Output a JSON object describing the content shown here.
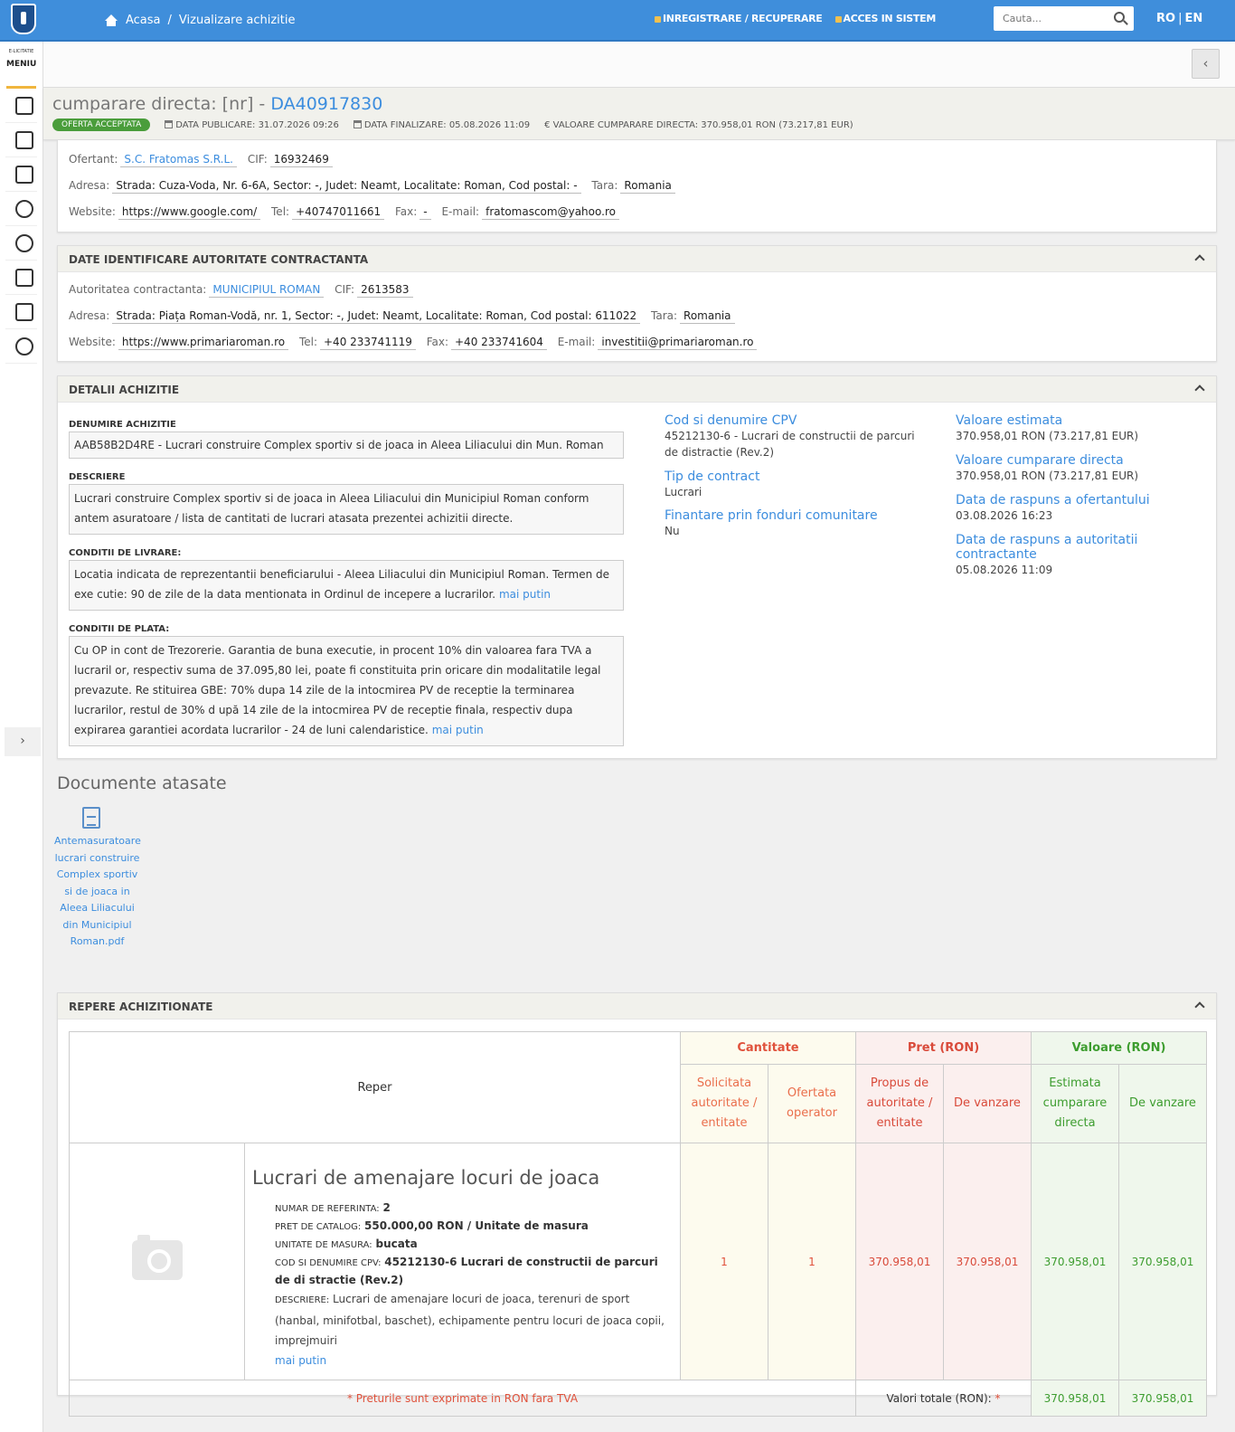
{
  "topbar": {
    "breadcrumb_home": "Acasa",
    "breadcrumb_sep": "/",
    "breadcrumb_current": "Vizualizare achizitie",
    "link_register": "INREGISTRARE / RECUPERARE",
    "link_login": "ACCES IN SISTEM",
    "search_placeholder": "Cauta...",
    "lang_ro": "RO",
    "lang_sep": "|",
    "lang_en": "EN"
  },
  "sidebar": {
    "brand_small": "E-LICITATIE",
    "menu_label": "MENIU",
    "icons": [
      "document-icon",
      "list-export-icon",
      "clipboard-check-icon",
      "help-icon",
      "user-hand-icon",
      "id-card-icon",
      "catalog-icon",
      "chat-icon"
    ],
    "expand_glyph": "›"
  },
  "header": {
    "collapse_glyph": "‹",
    "title_prefix": "cumparare directa: [nr] -",
    "title_id": "DA40917830",
    "status_badge": "OFERTA ACCEPTATA",
    "publish_date": "DATA PUBLICARE: 31.07.2026 09:26",
    "final_date": "DATA FINALIZARE: 05.08.2026 11:09",
    "value": "€ VALOARE CUMPARARE DIRECTA: 370.958,01  RON (73.217,81  EUR)"
  },
  "offerer": {
    "label_ofertant": "Ofertant:",
    "ofertant": "S.C. Fratomas S.R.L.",
    "label_cif": "CIF:",
    "cif": "16932469",
    "label_adresa": "Adresa:",
    "adresa": "Strada: Cuza-Voda, Nr. 6-6A, Sector: -, Judet: Neamt, Localitate: Roman, Cod postal: -",
    "label_tara": "Tara:",
    "tara": "Romania",
    "label_website": "Website:",
    "website": "https://www.google.com/",
    "label_tel": "Tel:",
    "tel": "+40747011661",
    "label_fax": "Fax:",
    "fax": "-",
    "label_email": "E-mail:",
    "email": "fratomascom@yahoo.ro"
  },
  "authority": {
    "heading": "DATE IDENTIFICARE AUTORITATE CONTRACTANTA",
    "label_autoritate": "Autoritatea contractanta:",
    "autoritate": "MUNICIPIUL ROMAN",
    "label_cif": "CIF:",
    "cif": "2613583",
    "label_adresa": "Adresa:",
    "adresa": "Strada: Piața Roman-Vodă, nr. 1, Sector: -, Judet: Neamt, Localitate: Roman, Cod postal: 611022",
    "label_tara": "Tara:",
    "tara": "Romania",
    "label_website": "Website:",
    "website": "https://www.primariaroman.ro",
    "label_tel": "Tel:",
    "tel": "+40 233741119",
    "label_fax": "Fax:",
    "fax": "+40 233741604",
    "label_email": "E-mail:",
    "email": "investitii@primariaroman.ro"
  },
  "details": {
    "heading": "DETALII ACHIZITIE",
    "label_denumire": "DENUMIRE ACHIZITIE",
    "denumire": "AAB58B2D4RE - Lucrari construire Complex sportiv si de joaca in Aleea Liliacului din Mun. Roman",
    "label_descriere": "DESCRIERE",
    "descriere": "Lucrari construire Complex sportiv si de joaca in Aleea Liliacului din Municipiul Roman conform antem asuratoare / lista de cantitati de lucrari atasata prezentei achizitii directe.",
    "label_livrare": "CONDITII DE LIVRARE:",
    "livrare": "Locatia indicata de reprezentantii beneficiarului - Aleea Liliacului din Municipiul Roman. Termen de exe cutie: 90 de zile de la data mentionata in Ordinul de incepere a lucrarilor.",
    "label_plata": "CONDITII DE PLATA:",
    "plata": "Cu OP in cont de Trezorerie. Garantia de buna executie, in procent 10% din valoarea fara TVA a lucraril or, respectiv suma de 37.095,80 lei, poate fi constituita prin oricare din modalitatile legal prevazute. Re stituirea GBE: 70% dupa 14 zile de la intocmirea PV de receptie la terminarea lucrarilor, restul de 30% d upă 14 zile de la intocmirea PV de receptie finala, respectiv dupa expirarea garantiei acordata lucrarilor - 24 de luni calendaristice.",
    "mai_putin": "mai putin",
    "cpv_label": "Cod si denumire CPV",
    "cpv": "45212130-6 - Lucrari de constructii de parcuri de distractie (Rev.2)",
    "tip_label": "Tip de contract",
    "tip": "Lucrari",
    "fonduri_label": "Finantare prin fonduri comunitare",
    "fonduri": "Nu",
    "val_est_label": "Valoare estimata",
    "val_est": "370.958,01  RON (73.217,81  EUR)",
    "val_cd_label": "Valoare cumparare directa",
    "val_cd": "370.958,01  RON (73.217,81  EUR)",
    "rasp_of_label": "Data de raspuns a ofertantului",
    "rasp_of": "03.08.2026 16:23",
    "rasp_aut_label": "Data de raspuns a autoritatii contractante",
    "rasp_aut": "05.08.2026 11:09"
  },
  "documents": {
    "heading": "Documente atasate",
    "file_name": "Antemasuratoare lucrari construire Complex sportiv si de joaca in Aleea Liliacului din Municipiul Roman.pdf"
  },
  "repere": {
    "heading": "REPERE ACHIZITIONATE",
    "col_reper": "Reper",
    "grp_cantitate": "Cantitate",
    "grp_pret": "Pret (RON)",
    "grp_valoare": "Valoare (RON)",
    "sub_solicitata": "Solicitata autoritate / entitate",
    "sub_ofertata": "Ofertata operator",
    "sub_propus": "Propus de autoritate / entitate",
    "sub_vanzare_pret": "De vanzare",
    "sub_estimata": "Estimata cumparare directa",
    "sub_vanzare_val": "De vanzare",
    "item": {
      "title": "Lucrari de amenajare locuri de joaca",
      "ref_label": "NUMAR DE REFERINTA:",
      "ref": "2",
      "pret_label": "PRET DE CATALOG:",
      "pret": "550.000,00  RON / Unitate de masura",
      "um_label": "UNITATE DE MASURA:",
      "um": "bucata",
      "cpv_label": "COD SI DENUMIRE CPV:",
      "cpv": "45212130-6 Lucrari de constructii de parcuri de di stractie (Rev.2)",
      "desc_label": "DESCRIERE:",
      "desc": "Lucrari de amenajare locuri de joaca, terenuri de sport (hanbal, minifotbal, baschet), echipamente pentru locuri de joaca copii, imprejmuiri",
      "mai_putin": "mai putin",
      "solicitata": "1",
      "ofertata": "1",
      "propus": "370.958,01",
      "vanzare_pret": "370.958,01",
      "estimata": "370.958,01",
      "vanzare_val": "370.958,01"
    },
    "footnote": "* Preturile sunt exprimate in RON fara TVA",
    "totals_label": "Valori totale (RON):",
    "totals_star": "*",
    "total_estimata": "370.958,01",
    "total_vanzare": "370.958,01"
  }
}
